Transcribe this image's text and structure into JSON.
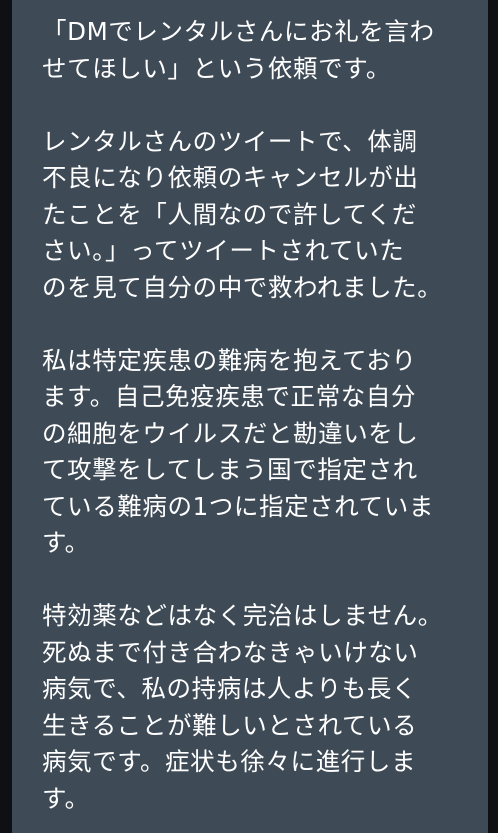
{
  "message": {
    "paragraphs": [
      "「DMでレンタルさんにお礼を言わ\nせてほしい」という依頼です。",
      "レンタルさんのツイートで、体調\n不良になり依頼のキャンセルが出\nたことを「人間なので許してくだ\nさい。」ってツイートされていた\nのを見て自分の中で救われました。",
      "私は特定疾患の難病を抱えており\nます。自己免疫疾患で正常な自分\nの細胞をウイルスだと勘違いをし\nて攻撃をしてしまう国で指定され\nている難病の1つに指定されていま\nす。",
      "特効薬などはなく完治はしません。\n死ぬまで付き合わなきゃいけない\n病気で、私の持病は人よりも長く\n生きることが難しいとされている\n病気です。症状も徐々に進行しま\nす。"
    ]
  },
  "colors": {
    "bubble_background": "#3e4a56",
    "text": "#ffffff",
    "outer_background": "#0b0d10"
  }
}
